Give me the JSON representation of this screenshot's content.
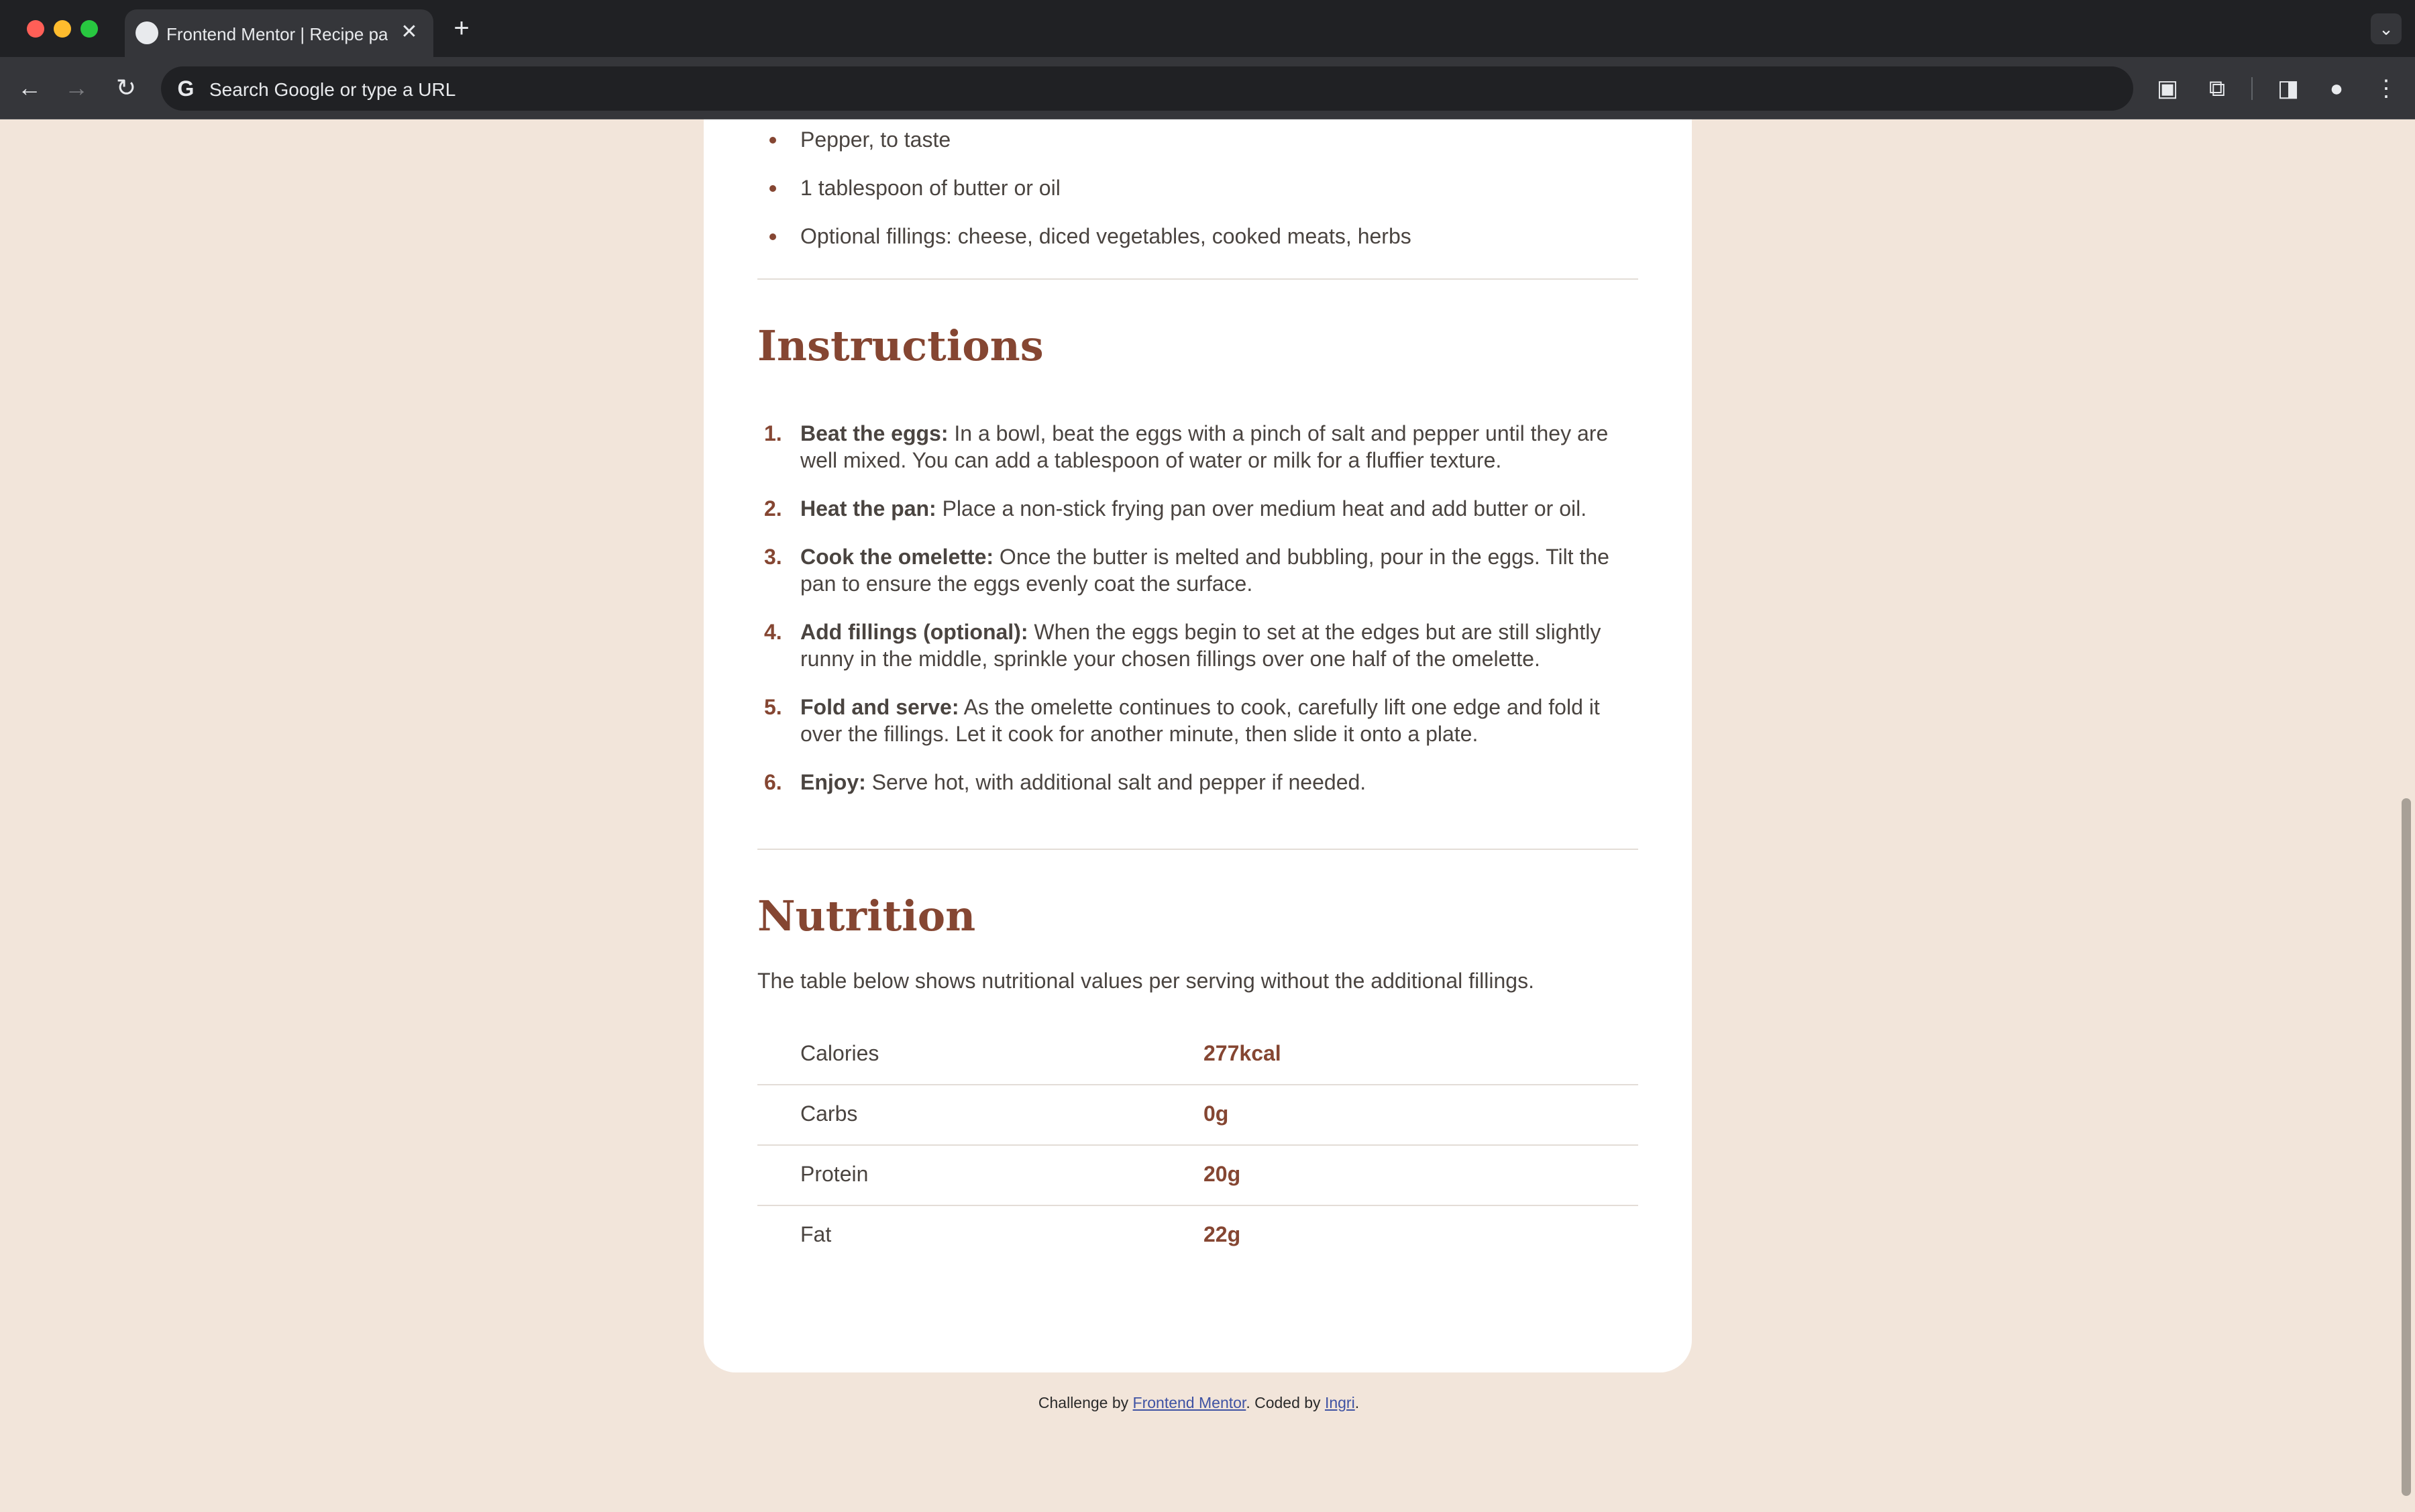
{
  "browser": {
    "tab_title": "Frontend Mentor | Recipe page",
    "omnibox_placeholder": "Search Google or type a URL",
    "icons": [
      "close-icon",
      "new-tab-icon",
      "back-icon",
      "forward-icon",
      "reload-icon",
      "google-icon",
      "extension-icon",
      "puzzle-icon",
      "side-panel-icon",
      "profile-icon",
      "menu-icon",
      "tab-list-icon"
    ]
  },
  "ingredients": {
    "items": [
      "Pepper, to taste",
      "1 tablespoon of butter or oil",
      "Optional fillings: cheese, diced vegetables, cooked meats, herbs"
    ]
  },
  "instructions": {
    "heading": "Instructions",
    "steps": [
      {
        "num": "1.",
        "title": "Beat the eggs:",
        "text": " In a bowl, beat the eggs with a pinch of salt and pepper until they are well mixed. You can add a tablespoon of water or milk for a fluffier texture."
      },
      {
        "num": "2.",
        "title": "Heat the pan:",
        "text": " Place a non-stick frying pan over medium heat and add butter or oil."
      },
      {
        "num": "3.",
        "title": "Cook the omelette:",
        "text": " Once the butter is melted and bubbling, pour in the eggs. Tilt the pan to ensure the eggs evenly coat the surface."
      },
      {
        "num": "4.",
        "title": "Add fillings (optional):",
        "text": " When the eggs begin to set at the edges but are still slightly runny in the middle, sprinkle your chosen fillings over one half of the omelette."
      },
      {
        "num": "5.",
        "title": "Fold and serve:",
        "text": " As the omelette continues to cook, carefully lift one edge and fold it over the fillings. Let it cook for another minute, then slide it onto a plate."
      },
      {
        "num": "6.",
        "title": "Enjoy:",
        "text": " Serve hot, with additional salt and pepper if needed."
      }
    ]
  },
  "nutrition": {
    "heading": "Nutrition",
    "description": "The table below shows nutritional values per serving without the additional fillings.",
    "rows": [
      {
        "label": "Calories",
        "value": "277kcal"
      },
      {
        "label": "Carbs",
        "value": "0g"
      },
      {
        "label": "Protein",
        "value": "20g"
      },
      {
        "label": "Fat",
        "value": "22g"
      }
    ]
  },
  "footer": {
    "prefix": "Challenge by ",
    "link1": "Frontend Mentor",
    "middle": ". Coded by ",
    "link2": "Ingri",
    "suffix": "."
  },
  "colors": {
    "page_bg": "#f2e5da",
    "accent_brown": "#854632",
    "text": "#4a4440"
  }
}
